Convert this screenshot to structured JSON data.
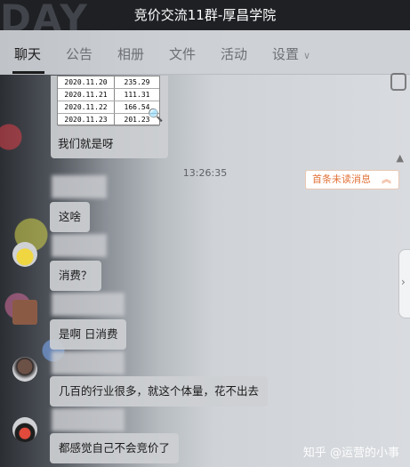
{
  "window": {
    "bg_deco_text": "DAY",
    "title": "竞价交流11群-厚昌学院"
  },
  "tabs": [
    {
      "label": "聊天",
      "active": true
    },
    {
      "label": "公告"
    },
    {
      "label": "相册"
    },
    {
      "label": "文件"
    },
    {
      "label": "活动"
    },
    {
      "label": "设置"
    }
  ],
  "settings_chevron": "∨",
  "unread": {
    "label": "首条未读消息",
    "icon": "double-up-chevron"
  },
  "table_image": {
    "rows": [
      {
        "date": "2020.11.20",
        "value": "235.29"
      },
      {
        "date": "2020.11.21",
        "value": "111.31"
      },
      {
        "date": "2020.11.22",
        "value": "166.54"
      },
      {
        "date": "2020.11.23",
        "value": "201.23"
      }
    ]
  },
  "messages": [
    {
      "text": "我们就是呀"
    },
    {
      "timestamp": "13:26:35"
    },
    {
      "text": "这啥"
    },
    {
      "text": "消费？"
    },
    {
      "text": "是啊 日消费"
    },
    {
      "text": "几百的行业很多，就这个体量，花不出去"
    },
    {
      "text": "都感觉自己不会竞价了"
    }
  ],
  "watermark": "知乎 @运营的小事",
  "colors": {
    "unread_accent": "#e2733a",
    "titlebar": "#1e2024"
  }
}
